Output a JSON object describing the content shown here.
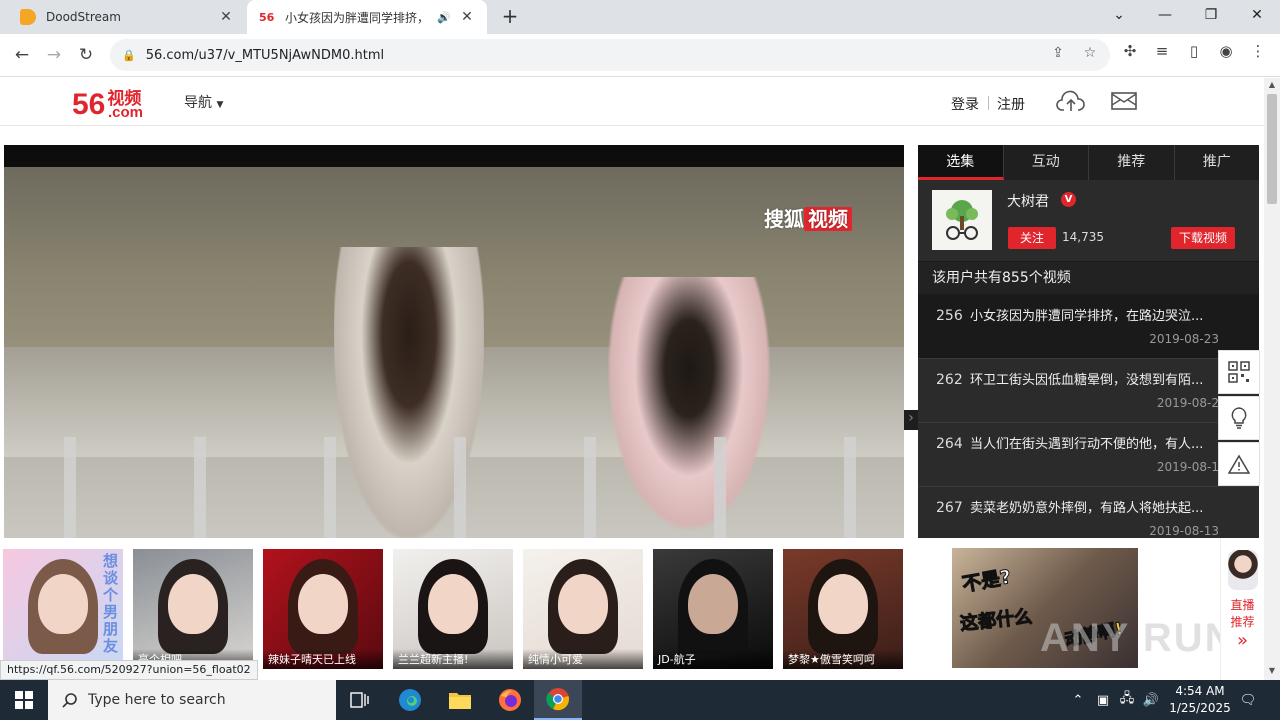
{
  "browser": {
    "tabs": [
      {
        "title": "DoodStream",
        "active": false
      },
      {
        "favicon_text": "56",
        "title": "小女孩因为胖遭同学排挤，",
        "active": true
      }
    ],
    "address": "56.com/u37/v_MTU5NjAwNDM0.html"
  },
  "site": {
    "logo_number": "56",
    "logo_cn": "视频",
    "logo_com": ".com",
    "nav_label": "导航",
    "login": "登录",
    "register": "注册"
  },
  "player": {
    "watermark_a": "搜狐",
    "watermark_b": "视频"
  },
  "panel": {
    "tabs": [
      "选集",
      "互动",
      "推荐",
      "推广"
    ],
    "uploader_name": "大树君",
    "verified_badge": "V",
    "follow_label": "关注",
    "followers": "14,735",
    "download_label": "下载视频",
    "video_count": "该用户共有855个视频",
    "episodes": [
      {
        "num": "256",
        "title": "小女孩因为胖遭同学排挤，在路边哭泣...",
        "date": "2019-08-23"
      },
      {
        "num": "262",
        "title": "环卫工街头因低血糖晕倒，没想到有陌...",
        "date": "2019-08-2"
      },
      {
        "num": "264",
        "title": "当人们在街头遇到行动不便的他，有人...",
        "date": "2019-08-1"
      },
      {
        "num": "267",
        "title": "卖菜老奶奶意外摔倒，有路人将她扶起...",
        "date": "2019-08-13"
      }
    ]
  },
  "bottom": {
    "thumbs": [
      {
        "caption": "",
        "overlay": "想谈个男朋友"
      },
      {
        "caption": "亮个相吧"
      },
      {
        "caption": "辣妹子晴天已上线"
      },
      {
        "caption": "兰兰超新主播!"
      },
      {
        "caption": "纯情小可爱"
      },
      {
        "caption": "JD-航子"
      },
      {
        "caption": "梦黎★傲雪笑呵呵"
      }
    ],
    "ad_text_1": "不是?",
    "ad_text_2": "这都什么",
    "ad_text_3": "动静啊!",
    "live_rec_1": "直播",
    "live_rec_2": "推荐",
    "live_more": "»",
    "watermark": "ANY RUN"
  },
  "status_url": "https://qf.56.com/520927?union=56_float02",
  "taskbar": {
    "search_placeholder": "Type here to search",
    "time": "4:54 AM",
    "date": "1/25/2025"
  },
  "colors": {
    "brand_red": "#e0262c",
    "panel_dark": "#2b2b2b",
    "taskbar": "#1f2a37"
  }
}
